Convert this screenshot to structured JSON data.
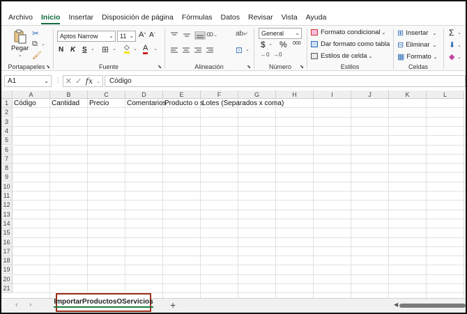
{
  "menu": {
    "tabs": [
      "Archivo",
      "Inicio",
      "Insertar",
      "Disposición de página",
      "Fórmulas",
      "Datos",
      "Revisar",
      "Vista",
      "Ayuda"
    ],
    "active": "Inicio"
  },
  "ribbon": {
    "clipboard": {
      "paste_label": "Pegar",
      "group_label": "Portapapeles"
    },
    "font": {
      "font_name": "Aptos Narrow",
      "font_size": "11",
      "bold": "N",
      "italic": "K",
      "underline": "S",
      "group_label": "Fuente"
    },
    "alignment": {
      "group_label": "Alineación"
    },
    "number": {
      "format": "General",
      "currency": "$",
      "percent": "%",
      "thousands": "000",
      "group_label": "Número"
    },
    "styles": {
      "conditional": "Formato condicional",
      "as_table": "Dar formato como tabla",
      "cell_styles": "Estilos de celda",
      "group_label": "Estilos"
    },
    "cells": {
      "insert": "Insertar",
      "delete": "Eliminar",
      "format": "Formato",
      "group_label": "Celdas"
    },
    "editing": {
      "sum": "Σ"
    }
  },
  "formula_bar": {
    "name_box": "A1",
    "fx": "fx",
    "content": "Código"
  },
  "grid": {
    "columns": [
      "A",
      "B",
      "C",
      "D",
      "E",
      "F",
      "G",
      "H",
      "I",
      "J",
      "K",
      "L"
    ],
    "rows": [
      "1",
      "2",
      "3",
      "4",
      "5",
      "6",
      "7",
      "8",
      "9",
      "10",
      "11",
      "12",
      "13",
      "14",
      "15",
      "16",
      "17",
      "18",
      "19",
      "20",
      "21"
    ],
    "row1": [
      "Código",
      "Cantidad",
      "Precio",
      "Comentarios",
      "Producto o s",
      "Lotes (Separados x coma)"
    ]
  },
  "sheets": {
    "active_tab": "ImportarProductosOServicios",
    "add": "+"
  }
}
